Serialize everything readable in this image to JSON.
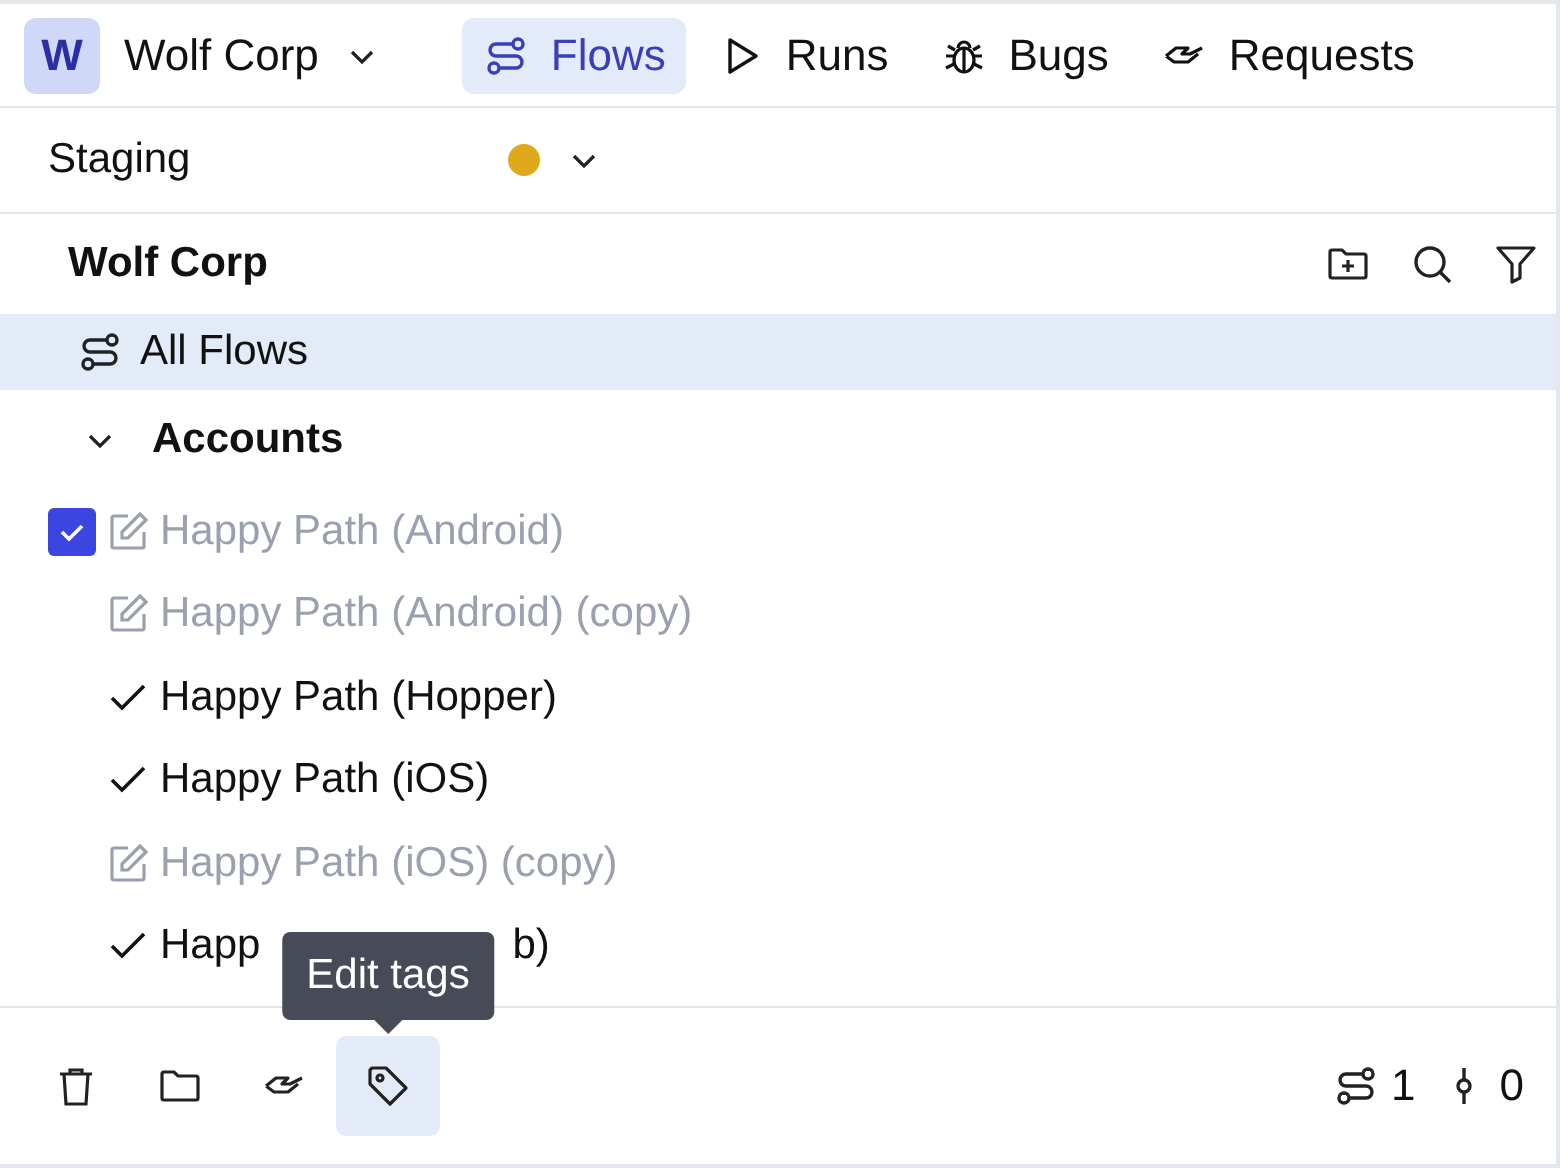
{
  "workspace": {
    "initial": "W",
    "name": "Wolf Corp"
  },
  "tabs": [
    {
      "kind": "flows",
      "label": "Flows",
      "selected": true
    },
    {
      "kind": "runs",
      "label": "Runs",
      "selected": false
    },
    {
      "kind": "bugs",
      "label": "Bugs",
      "selected": false
    },
    {
      "kind": "requests",
      "label": "Requests",
      "selected": false
    }
  ],
  "environment": {
    "name": "Staging",
    "color": "#e0a91b"
  },
  "tree": {
    "title": "Wolf Corp",
    "all_flows": {
      "label": "All Flows",
      "selected": true
    },
    "folders": [
      {
        "name": "Accounts",
        "expanded": true,
        "items": [
          {
            "kind": "draft",
            "label": "Happy Path (Android)",
            "checked": true
          },
          {
            "kind": "draft",
            "label": "Happy Path (Android) (copy)",
            "checked": false
          },
          {
            "kind": "done",
            "label": "Happy Path (Hopper)",
            "checked": false
          },
          {
            "kind": "done",
            "label": "Happy Path (iOS)",
            "checked": false
          },
          {
            "kind": "draft",
            "label": "Happy Path (iOS) (copy)",
            "checked": false
          },
          {
            "kind": "done",
            "label": "Happ",
            "label_end": "b)",
            "checked": false
          }
        ]
      }
    ]
  },
  "footer": {
    "actions": [
      {
        "kind": "delete",
        "selected": false
      },
      {
        "kind": "move",
        "selected": false
      },
      {
        "kind": "request",
        "selected": false
      },
      {
        "kind": "tags",
        "selected": true,
        "tooltip": "Edit tags"
      }
    ],
    "flow_count": "1",
    "commit_count": "0"
  }
}
